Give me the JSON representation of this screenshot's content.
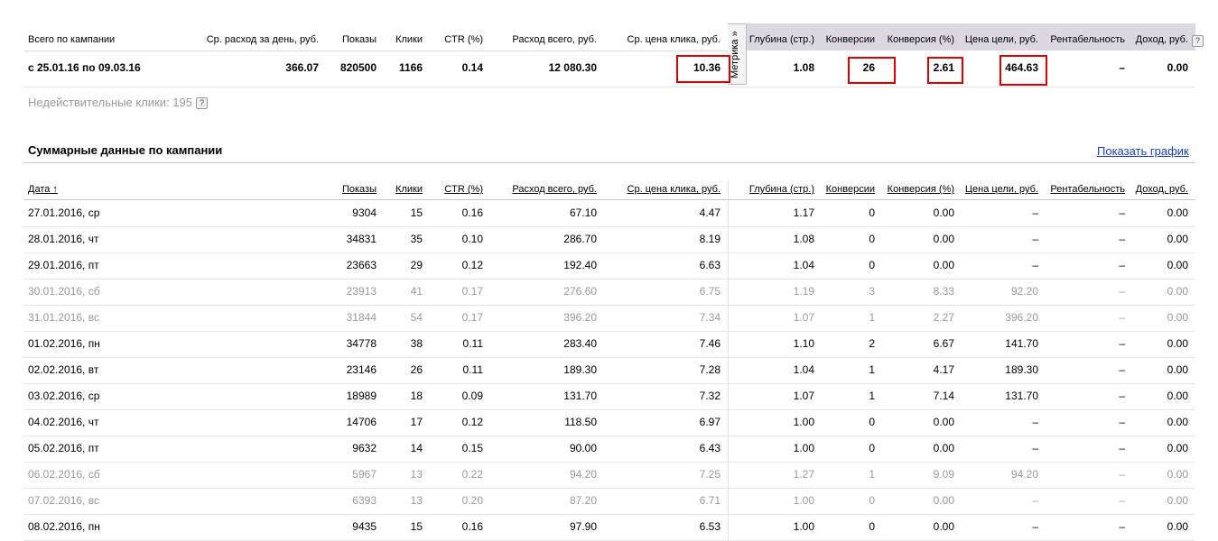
{
  "summary": {
    "labels": {
      "total": "Всего по кампании",
      "avg_daily": "Ср. расход за день, руб.",
      "shows": "Показы",
      "clicks": "Клики",
      "ctr": "CTR (%)",
      "spend_total": "Расход всего, руб.",
      "avg_cpc": "Ср. цена клика, руб.",
      "depth": "Глубина (стр.)",
      "conversions": "Конверсии",
      "conv_rate": "Конверсия (%)",
      "goal_price": "Цена цели, руб.",
      "profitability": "Рентабельность",
      "income": "Доход, руб."
    },
    "period": "с 25.01.16 по 09.03.16",
    "avg_daily": "366.07",
    "shows": "820500",
    "clicks": "1166",
    "ctr": "0.14",
    "spend_total": "12 080.30",
    "avg_cpc": "10.36",
    "depth": "1.08",
    "conversions": "26",
    "conv_rate": "2.61",
    "goal_price": "464.63",
    "profitability": "–",
    "income": "0.00"
  },
  "metrika_tab": "Метрика »",
  "invalid_clicks": "Недействительные клики: 195",
  "help_icon": "?",
  "section_title": "Суммарные данные по кампании",
  "show_chart_link": "Показать график",
  "columns": {
    "date": "Дата ↑",
    "shows": "Показы",
    "clicks": "Клики",
    "ctr": "CTR (%)",
    "spend": "Расход всего, руб.",
    "cpc": "Ср. цена клика, руб.",
    "depth": "Глубина (стр.)",
    "conversions": "Конверсии",
    "conv_rate": "Конверсия (%)",
    "goal_price": "Цена цели, руб.",
    "profitability": "Рентабельность",
    "income": "Доход, руб."
  },
  "rows": [
    {
      "date": "27.01.2016, ср",
      "shows": "9304",
      "clicks": "15",
      "ctr": "0.16",
      "spend": "67.10",
      "cpc": "4.47",
      "depth": "1.17",
      "conv": "0",
      "conv_rate": "0.00",
      "goal": "–",
      "profit": "–",
      "income": "0.00",
      "weekend": false
    },
    {
      "date": "28.01.2016, чт",
      "shows": "34831",
      "clicks": "35",
      "ctr": "0.10",
      "spend": "286.70",
      "cpc": "8.19",
      "depth": "1.08",
      "conv": "0",
      "conv_rate": "0.00",
      "goal": "–",
      "profit": "–",
      "income": "0.00",
      "weekend": false
    },
    {
      "date": "29.01.2016, пт",
      "shows": "23663",
      "clicks": "29",
      "ctr": "0.12",
      "spend": "192.40",
      "cpc": "6.63",
      "depth": "1.04",
      "conv": "0",
      "conv_rate": "0.00",
      "goal": "–",
      "profit": "–",
      "income": "0.00",
      "weekend": false
    },
    {
      "date": "30.01.2016, сб",
      "shows": "23913",
      "clicks": "41",
      "ctr": "0.17",
      "spend": "276.60",
      "cpc": "6.75",
      "depth": "1.19",
      "conv": "3",
      "conv_rate": "8.33",
      "goal": "92.20",
      "profit": "–",
      "income": "0.00",
      "weekend": true
    },
    {
      "date": "31.01.2016, вс",
      "shows": "31844",
      "clicks": "54",
      "ctr": "0.17",
      "spend": "396.20",
      "cpc": "7.34",
      "depth": "1.07",
      "conv": "1",
      "conv_rate": "2.27",
      "goal": "396.20",
      "profit": "–",
      "income": "0.00",
      "weekend": true
    },
    {
      "date": "01.02.2016, пн",
      "shows": "34778",
      "clicks": "38",
      "ctr": "0.11",
      "spend": "283.40",
      "cpc": "7.46",
      "depth": "1.10",
      "conv": "2",
      "conv_rate": "6.67",
      "goal": "141.70",
      "profit": "–",
      "income": "0.00",
      "weekend": false
    },
    {
      "date": "02.02.2016, вт",
      "shows": "23146",
      "clicks": "26",
      "ctr": "0.11",
      "spend": "189.30",
      "cpc": "7.28",
      "depth": "1.04",
      "conv": "1",
      "conv_rate": "4.17",
      "goal": "189.30",
      "profit": "–",
      "income": "0.00",
      "weekend": false
    },
    {
      "date": "03.02.2016, ср",
      "shows": "18989",
      "clicks": "18",
      "ctr": "0.09",
      "spend": "131.70",
      "cpc": "7.32",
      "depth": "1.07",
      "conv": "1",
      "conv_rate": "7.14",
      "goal": "131.70",
      "profit": "–",
      "income": "0.00",
      "weekend": false
    },
    {
      "date": "04.02.2016, чт",
      "shows": "14706",
      "clicks": "17",
      "ctr": "0.12",
      "spend": "118.50",
      "cpc": "6.97",
      "depth": "1.00",
      "conv": "0",
      "conv_rate": "0.00",
      "goal": "–",
      "profit": "–",
      "income": "0.00",
      "weekend": false
    },
    {
      "date": "05.02.2016, пт",
      "shows": "9632",
      "clicks": "14",
      "ctr": "0.15",
      "spend": "90.00",
      "cpc": "6.43",
      "depth": "1.00",
      "conv": "0",
      "conv_rate": "0.00",
      "goal": "–",
      "profit": "–",
      "income": "0.00",
      "weekend": false
    },
    {
      "date": "06.02.2016, сб",
      "shows": "5967",
      "clicks": "13",
      "ctr": "0.22",
      "spend": "94.20",
      "cpc": "7.25",
      "depth": "1.27",
      "conv": "1",
      "conv_rate": "9.09",
      "goal": "94.20",
      "profit": "–",
      "income": "0.00",
      "weekend": true
    },
    {
      "date": "07.02.2016, вс",
      "shows": "6393",
      "clicks": "13",
      "ctr": "0.20",
      "spend": "87.20",
      "cpc": "6.71",
      "depth": "1.00",
      "conv": "0",
      "conv_rate": "0.00",
      "goal": "–",
      "profit": "–",
      "income": "0.00",
      "weekend": true
    },
    {
      "date": "08.02.2016, пн",
      "shows": "9435",
      "clicks": "15",
      "ctr": "0.16",
      "spend": "97.90",
      "cpc": "6.53",
      "depth": "1.00",
      "conv": "0",
      "conv_rate": "0.00",
      "goal": "–",
      "profit": "–",
      "income": "0.00",
      "weekend": false
    }
  ]
}
